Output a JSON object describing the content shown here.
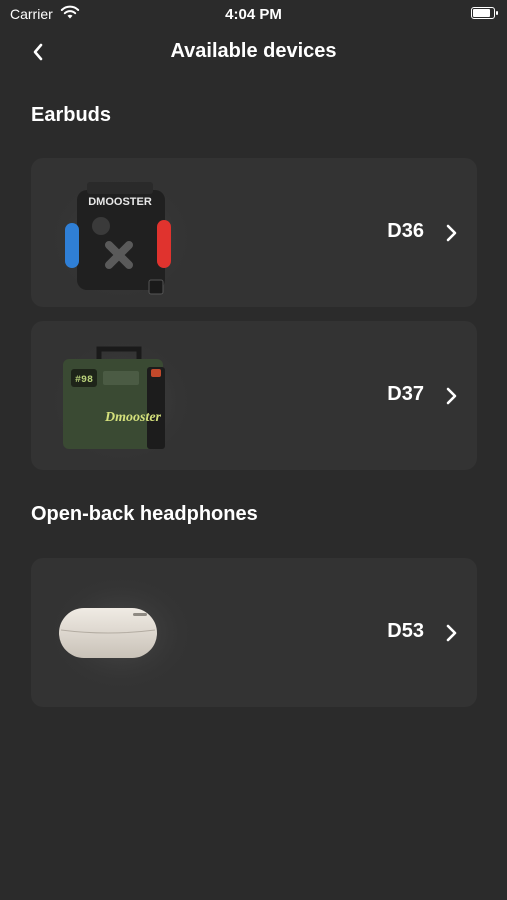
{
  "status_bar": {
    "carrier": "Carrier",
    "time": "4:04 PM",
    "wifi_icon": "wifi-icon",
    "battery_icon": "battery-icon"
  },
  "nav": {
    "title": "Available devices",
    "back_icon": "chevron-left-icon"
  },
  "sections": [
    {
      "title": "Earbuds",
      "devices": [
        {
          "name": "D36",
          "image_brand_text": "DMOOSTER",
          "icon": "chevron-right-icon"
        },
        {
          "name": "D37",
          "image_brand_text": "Dmooster",
          "image_badge_text": "#98",
          "icon": "chevron-right-icon"
        }
      ]
    },
    {
      "title": "Open-back headphones",
      "devices": [
        {
          "name": "D53",
          "icon": "chevron-right-icon"
        }
      ]
    }
  ],
  "colors": {
    "background": "#2b2b2b",
    "card": "#333333",
    "text": "#ffffff",
    "accent_blue": "#2f7fd6",
    "accent_red": "#e0332e",
    "d37_green": "#3a4a33",
    "d53_case": "#e2dcd3"
  }
}
